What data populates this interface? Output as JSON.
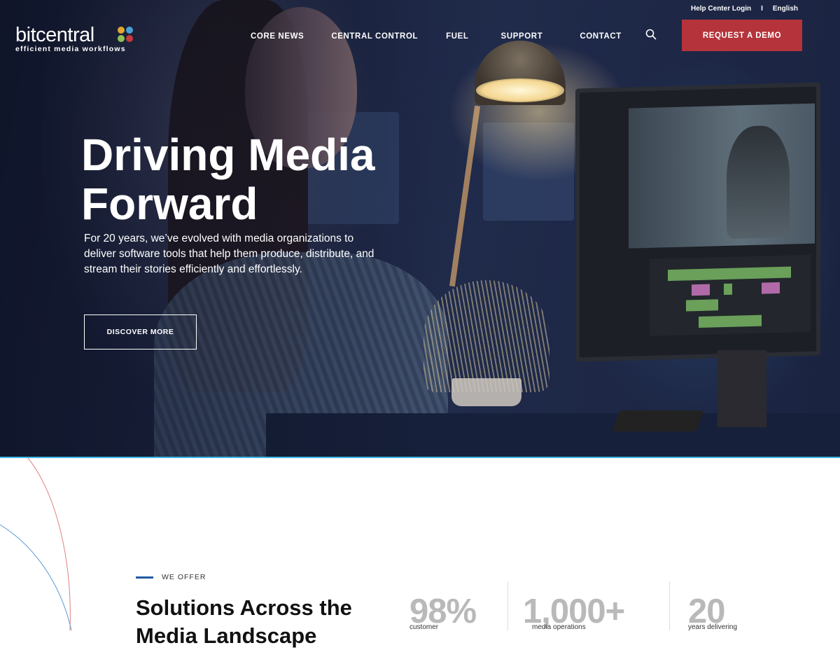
{
  "utility_nav": {
    "help_center": "Help Center Login",
    "separator": "I",
    "language": "English"
  },
  "logo": {
    "wordmark": "bitcentral",
    "tagline": "efficient media workflows",
    "mark_colors": [
      "#e2a72e",
      "#4aa0d4",
      "#8dc153",
      "#c8383e"
    ]
  },
  "nav": {
    "items": [
      "CORE NEWS",
      "CENTRAL CONTROL",
      "FUEL",
      "SUPPORT",
      "CONTACT"
    ]
  },
  "search_icon": "search-icon",
  "cta": {
    "request_demo": "REQUEST A DEMO"
  },
  "hero": {
    "title_line1": "Driving Media",
    "title_line2": "Forward",
    "subtitle": "For 20 years, we’ve evolved with media organizations to deliver software tools that help them produce, distribute, and stream their stories efficiently and effortlessly.",
    "button": "DISCOVER MORE"
  },
  "offer": {
    "eyebrow": "WE OFFER",
    "title": "Solutions Across the Media Landscape",
    "stats": [
      {
        "value": "98%",
        "label": "customer"
      },
      {
        "value": "1,000+",
        "label": "media operations"
      },
      {
        "value": "20",
        "label": "years delivering"
      }
    ]
  },
  "colors": {
    "accent_red": "#b5333a",
    "accent_blue": "#1f5aa0",
    "hero_divider": "#3fb8e6"
  }
}
